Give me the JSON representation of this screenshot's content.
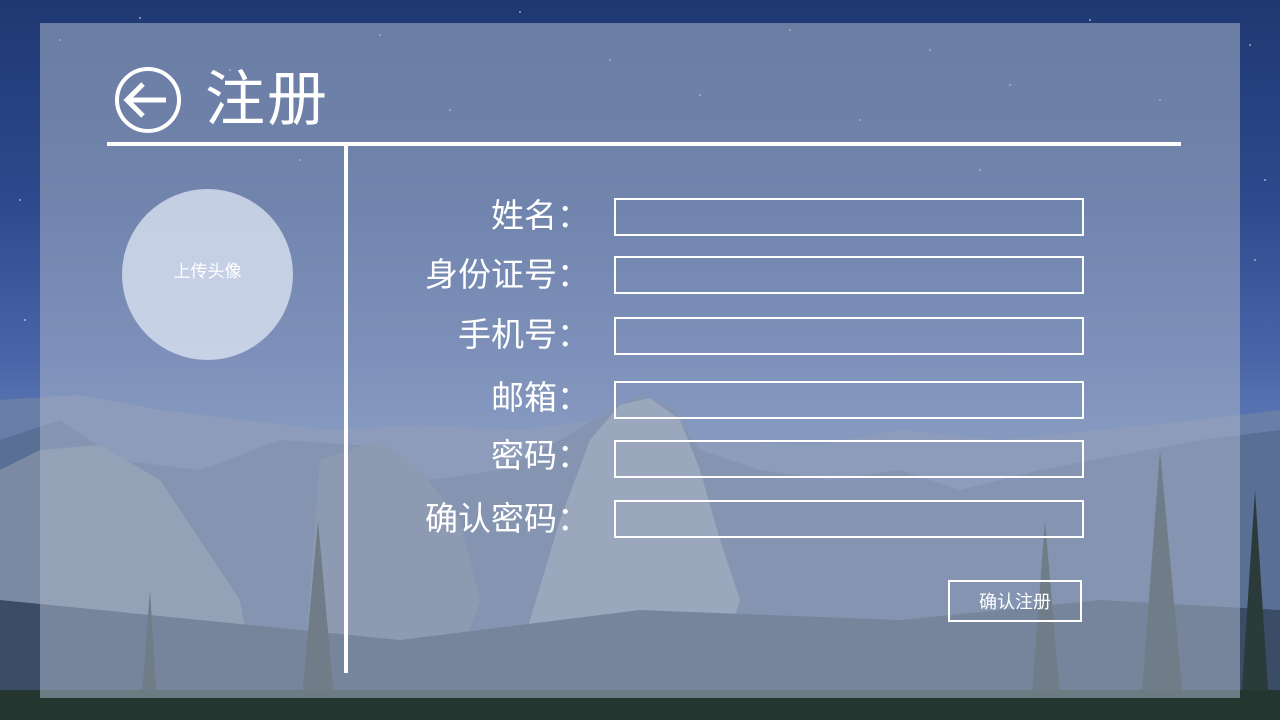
{
  "header": {
    "title": "注册",
    "back_icon": "arrow-left-circle-icon"
  },
  "avatar": {
    "label": "上传头像"
  },
  "form": {
    "fields": [
      {
        "label": "姓名：",
        "value": ""
      },
      {
        "label": "身份证号：",
        "value": ""
      },
      {
        "label": "手机号：",
        "value": ""
      },
      {
        "label": "邮箱：",
        "value": ""
      },
      {
        "label": "密码：",
        "value": ""
      },
      {
        "label": "确认密码：",
        "value": ""
      }
    ],
    "submit_label": "确认注册"
  },
  "colors": {
    "line": "#ffffff",
    "text": "#ffffff"
  }
}
